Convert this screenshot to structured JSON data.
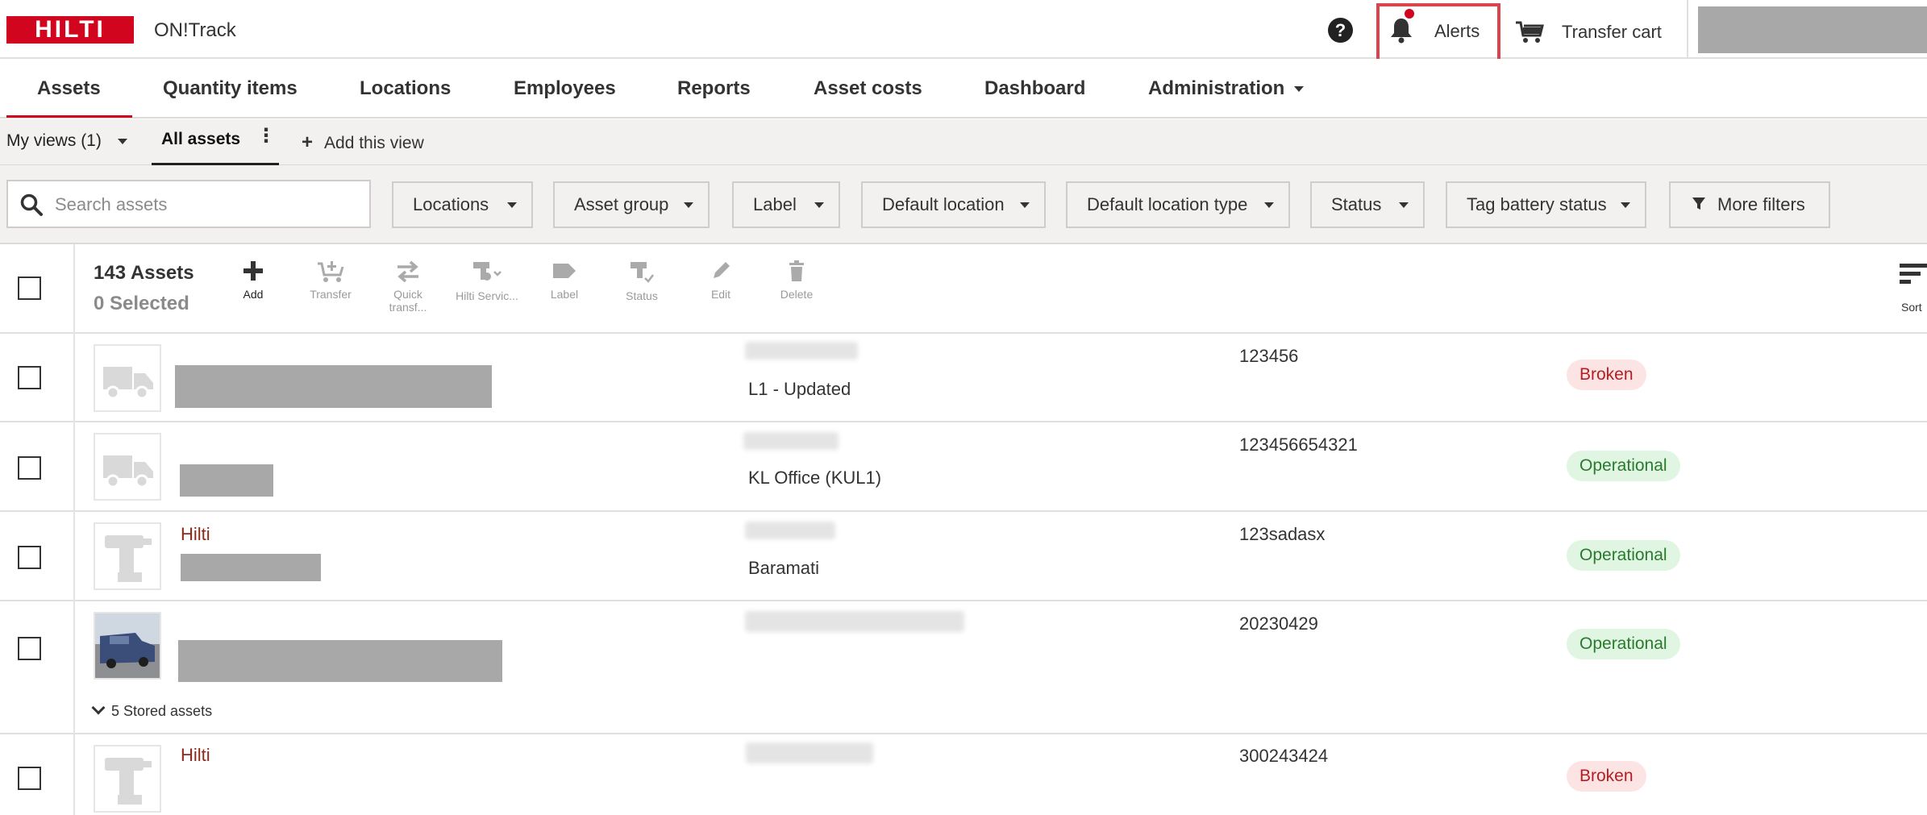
{
  "header": {
    "logo_text": "HILTI",
    "app_name": "ON!Track",
    "help_label": "?",
    "alerts_label": "Alerts",
    "transfer_cart_label": "Transfer cart",
    "brand_color": "#d2051e"
  },
  "nav": {
    "items": [
      {
        "label": "Assets",
        "active": true
      },
      {
        "label": "Quantity items"
      },
      {
        "label": "Locations"
      },
      {
        "label": "Employees"
      },
      {
        "label": "Reports"
      },
      {
        "label": "Asset costs"
      },
      {
        "label": "Dashboard"
      },
      {
        "label": "Administration",
        "has_dropdown": true
      }
    ]
  },
  "views": {
    "my_views_label": "My views",
    "my_views_count": "(1)",
    "active_view_label": "All assets",
    "add_view_label": "Add this view"
  },
  "filters": {
    "search_placeholder": "Search assets",
    "buttons": [
      {
        "label": "Locations"
      },
      {
        "label": "Asset group"
      },
      {
        "label": "Label"
      },
      {
        "label": "Default location"
      },
      {
        "label": "Default location type"
      },
      {
        "label": "Status"
      },
      {
        "label": "Tag battery status"
      }
    ],
    "more_filters_label": "More filters"
  },
  "toolbar": {
    "count_label": "143 Assets",
    "selected_label": "0 Selected",
    "actions": [
      {
        "label": "Add",
        "icon": "plus-icon",
        "enabled": true
      },
      {
        "label": "Transfer",
        "icon": "cart-add-icon",
        "enabled": false
      },
      {
        "label": "Quick transf...",
        "icon": "swap-arrows-icon",
        "enabled": false
      },
      {
        "label": "Hilti Servic...",
        "icon": "drill-service-icon",
        "enabled": false
      },
      {
        "label": "Label",
        "icon": "tag-icon",
        "enabled": false
      },
      {
        "label": "Status",
        "icon": "drill-status-icon",
        "enabled": false
      },
      {
        "label": "Edit",
        "icon": "pencil-icon",
        "enabled": false
      },
      {
        "label": "Delete",
        "icon": "trash-icon",
        "enabled": false
      }
    ],
    "sort_label": "Sort"
  },
  "rows": [
    {
      "thumb": "truck-icon",
      "brand": "",
      "location": "L1 - Updated",
      "asset_no": "123456",
      "status": "Broken"
    },
    {
      "thumb": "truck-icon",
      "brand": "",
      "location": "KL Office (KUL1)",
      "asset_no": "123456654321",
      "status": "Operational"
    },
    {
      "thumb": "drill-icon",
      "brand": "Hilti",
      "location": "Baramati",
      "asset_no": "123sadasx",
      "status": "Operational"
    },
    {
      "thumb": "photo",
      "brand": "",
      "location": "",
      "asset_no": "20230429",
      "status": "Operational",
      "stored": "5 Stored assets"
    },
    {
      "thumb": "drill-icon",
      "brand": "Hilti",
      "location": "",
      "asset_no": "300243424",
      "status": "Broken"
    }
  ],
  "colors": {
    "broken_bg": "#fde4e4",
    "broken_text": "#b51d20",
    "operational_bg": "#e0f5e2",
    "operational_text": "#2a7a2e"
  }
}
